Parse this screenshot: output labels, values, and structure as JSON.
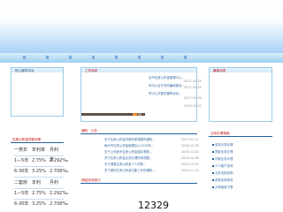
{
  "header": {
    "banner": ""
  },
  "sidebar_left": {
    "login_title": "网上服务平台",
    "rate_title": "住房公积金贷款利率",
    "rate_rows": [
      {
        "term": "一类年",
        "rate": "年利率",
        "mrate": "月利率"
      },
      {
        "term": "1—5年",
        "rate": "2.75%",
        "mrate": "2.292‰"
      },
      {
        "term": "6-30年",
        "rate": "3.25%",
        "mrate": "2.708‰"
      },
      {
        "term": "二套房",
        "rate": "年利",
        "mrate": "月利"
      },
      {
        "term": "1—5年",
        "rate": "2.75%",
        "mrate": "2.292‰"
      },
      {
        "term": "6-30年",
        "rate": "3.25%",
        "mrate": "2.708‰"
      }
    ]
  },
  "center": {
    "work_title": "工作动态",
    "work_items": [
      {
        "text": "全市住房公积金管理中心...",
        "date": "2017-02-28"
      },
      {
        "text": "市中心召开党风廉政建设...",
        "date": "2017-02-15"
      },
      {
        "text": "市中心开展学雷锋活动...",
        "date": "2017-01-06"
      },
      {
        "text": "",
        "date": "2016-12-20"
      }
    ],
    "notice_title": "通知 · 公告",
    "notice_items": [
      {
        "text": "关于住房公积金贷款利率调整的通知...",
        "date": "2017-01-11"
      },
      {
        "text": "赣州市住房公积金管理中心2016年...",
        "date": "2016-12-26"
      },
      {
        "text": "关于公布我市住房公积金缴存基数...",
        "date": "2016-12-20"
      },
      {
        "text": "关于住房公积金业务办理时间调整...",
        "date": "2016-12-08"
      },
      {
        "text": "关于调整住房公积金个人贷款...",
        "date": "2016-11-25"
      },
      {
        "text": "关于做好住房公积金归集工作的通知...",
        "date": "2016-11-10"
      }
    ],
    "counter_title": "网站访问统计",
    "counter_value": "12329"
  },
  "sidebar_right": {
    "top_title": "最新动态",
    "service_title": "业务办理指南",
    "service_items": [
      "缴存业务办理",
      "提取业务办理",
      "贷款业务办理",
      "个人账户查询",
      "业务流程说明",
      "政策法规查询",
      "办事指南下载"
    ]
  },
  "colors": {
    "accent": "#1f5f9f",
    "title": "#c00000",
    "border": "#9ccbe9"
  }
}
